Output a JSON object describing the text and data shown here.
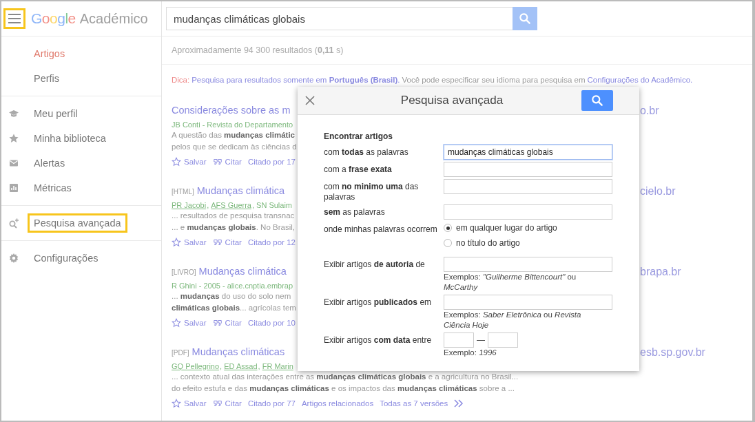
{
  "sidebar": {
    "menu_highlighted": true,
    "logo": {
      "brand": "Google",
      "product": "Académico"
    },
    "sections": [
      [
        {
          "label": "Artigos",
          "selected": true,
          "highlighted": false
        },
        {
          "label": "Perfis",
          "selected": false,
          "highlighted": false
        }
      ],
      [
        {
          "label": "Meu perfil",
          "selected": false,
          "highlighted": false
        },
        {
          "label": "Minha biblioteca",
          "selected": false,
          "highlighted": false
        },
        {
          "label": "Alertas",
          "selected": false,
          "highlighted": false
        },
        {
          "label": "Métricas",
          "selected": false,
          "highlighted": false
        }
      ],
      [
        {
          "label": "Pesquisa avançada",
          "selected": false,
          "highlighted": true
        }
      ],
      [
        {
          "label": "Configurações",
          "selected": false,
          "highlighted": false
        }
      ]
    ]
  },
  "search": {
    "value": "mudanças climáticas globais"
  },
  "results_count": "Aproximadamente 94 300 resultados (**0,11** s)",
  "tip": {
    "label": "Dica:",
    "link": "Pesquisa para resultados somente em **Português (Brasil)**.",
    "text": "Você pode especificar seu idioma para pesquisa em",
    "settings_link": "Configurações do Acadêmico."
  },
  "results": [
    {
      "title": "Considerações sobre as m",
      "source": "o.br",
      "authors": [
        {
          "text": "JB Conti - Revista do Departamento",
          "linked": false
        }
      ],
      "snippet": [
        "A questão das **mudanças climátic**",
        "pelos que se dedicam às ciências d"
      ],
      "actions": [
        {
          "kind": "save",
          "label": "Salvar"
        },
        {
          "kind": "cite",
          "label": "Citar"
        },
        {
          "kind": "link",
          "label": "Citado por 17"
        }
      ]
    },
    {
      "tag": "[HTML]",
      "title": "Mudanças climática",
      "source": "cielo.br",
      "authors": [
        {
          "text": "PR Jacobi",
          "linked": true
        },
        {
          "text": ", ",
          "linked": false
        },
        {
          "text": "AFS Guerra",
          "linked": true
        },
        {
          "text": ", SN Sulaim",
          "linked": false
        }
      ],
      "snippet": [
        "... resultados de pesquisa transnac",
        "... e **mudanças globais**. No Brasil,"
      ],
      "actions": [
        {
          "kind": "save",
          "label": "Salvar"
        },
        {
          "kind": "cite",
          "label": "Citar"
        },
        {
          "kind": "link",
          "label": "Citado por 12"
        }
      ]
    },
    {
      "tag": "[LIVRO]",
      "title": "Mudanças climática",
      "source": "brapa.br",
      "authors": [
        {
          "text": "R Ghini - 2005 - alice.cnptia.embrap",
          "linked": false
        }
      ],
      "snippet": [
        "... **mudanças** do uso do solo nem",
        "**climáticas globais**... agrícolas tem"
      ],
      "actions": [
        {
          "kind": "save",
          "label": "Salvar"
        },
        {
          "kind": "cite",
          "label": "Citar"
        },
        {
          "kind": "link",
          "label": "Citado por 10"
        }
      ]
    },
    {
      "tag": "[PDF]",
      "title": "Mudanças climáticas",
      "source": "esb.sp.gov.br",
      "authors": [
        {
          "text": "GQ Pellegrino",
          "linked": true
        },
        {
          "text": ", ",
          "linked": false
        },
        {
          "text": "ED Assad",
          "linked": true
        },
        {
          "text": ", ",
          "linked": false
        },
        {
          "text": "FR Marin",
          "linked": true
        }
      ],
      "snippet": [
        "... contexto atual das interações entre as **mudanças climáticas globais** e a agricultura no Brasil...",
        "do efeito estufa e das **mudanças climáticas** e os impactos das **mudanças climáticas** sobre a ..."
      ],
      "actions": [
        {
          "kind": "save",
          "label": "Salvar"
        },
        {
          "kind": "cite",
          "label": "Citar"
        },
        {
          "kind": "link",
          "label": "Citado por 77"
        },
        {
          "kind": "link",
          "label": "Artigos relacionados"
        },
        {
          "kind": "link",
          "label": "Todas as 7 versões"
        },
        {
          "kind": "more"
        }
      ]
    }
  ],
  "dialog": {
    "title": "Pesquisa avançada",
    "section": "Encontrar artigos",
    "rows": [
      {
        "kind": "text",
        "label": "com **todas** as palavras",
        "value": "mudanças climáticas globais",
        "focused": true
      },
      {
        "kind": "text",
        "label": "com a **frase exata**",
        "focused": false
      },
      {
        "kind": "text",
        "label": "com **no minimo uma** das palavras",
        "focused": false
      },
      {
        "kind": "text",
        "label": "**sem** as palavras",
        "focused": false
      },
      {
        "kind": "radio",
        "label": "onde minhas palavras ocorrem",
        "options": [
          {
            "label": "em qualquer lugar do artigo",
            "selected": true
          },
          {
            "label": "no título do artigo",
            "selected": false
          }
        ]
      },
      {
        "kind": "text",
        "label": "Exibir artigos **de autoria** de",
        "focused": false,
        "hint": "Exemplos: *\"Guilherme Bittencourt\"* ou *McCarthy*"
      },
      {
        "kind": "text",
        "label": "Exibir artigos **publicados** em",
        "focused": false,
        "hint": "Exemplos: *Saber Eletrônica* ou *Revista Ciência Hoje*"
      },
      {
        "kind": "range",
        "label": "Exibir artigos **com data** entre",
        "separator": "—",
        "hint": "Exemplo: *1996*"
      }
    ]
  }
}
